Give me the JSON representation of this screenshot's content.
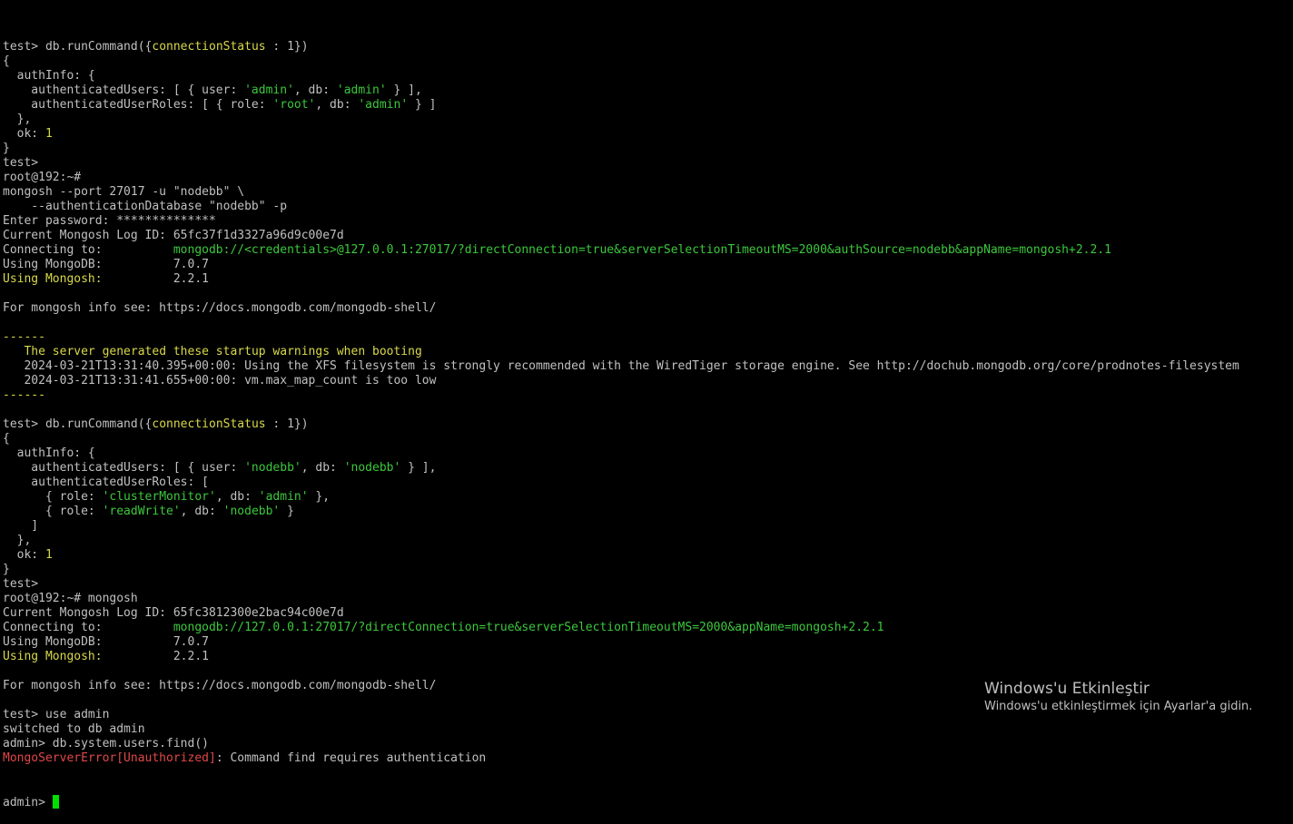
{
  "terminal": {
    "lines": [
      [
        {
          "t": "test> db.runCommand({",
          "c": "k"
        },
        {
          "t": "connectionStatus",
          "c": "y"
        },
        {
          "t": " : 1})",
          "c": "k"
        }
      ],
      [
        {
          "t": "{",
          "c": "k"
        }
      ],
      [
        {
          "t": "  authInfo: {",
          "c": "k"
        }
      ],
      [
        {
          "t": "    authenticatedUsers: [ { user: ",
          "c": "k"
        },
        {
          "t": "'admin'",
          "c": "g"
        },
        {
          "t": ", db: ",
          "c": "k"
        },
        {
          "t": "'admin'",
          "c": "g"
        },
        {
          "t": " } ],",
          "c": "k"
        }
      ],
      [
        {
          "t": "    authenticatedUserRoles: [ { role: ",
          "c": "k"
        },
        {
          "t": "'root'",
          "c": "g"
        },
        {
          "t": ", db: ",
          "c": "k"
        },
        {
          "t": "'admin'",
          "c": "g"
        },
        {
          "t": " } ]",
          "c": "k"
        }
      ],
      [
        {
          "t": "  },",
          "c": "k"
        }
      ],
      [
        {
          "t": "  ok: ",
          "c": "k"
        },
        {
          "t": "1",
          "c": "y"
        }
      ],
      [
        {
          "t": "}",
          "c": "k"
        }
      ],
      [
        {
          "t": "test>",
          "c": "k"
        }
      ],
      [
        {
          "t": "root@192:~#",
          "c": "k"
        }
      ],
      [
        {
          "t": "mongosh --port 27017 -u \"nodebb\" \\",
          "c": "k"
        }
      ],
      [
        {
          "t": "    --authenticationDatabase \"nodebb\" -p",
          "c": "k"
        }
      ],
      [
        {
          "t": "Enter password: **************",
          "c": "k"
        }
      ],
      [
        {
          "t": "Current Mongosh Log ID: 65fc37f1d3327a96d9c00e7d",
          "c": "k"
        }
      ],
      [
        {
          "t": "Connecting to:          ",
          "c": "k"
        },
        {
          "t": "mongodb://<credentials>@127.0.0.1:27017/?directConnection=true&serverSelectionTimeoutMS=2000&authSource=nodebb&appName=mongosh+2.2.1",
          "c": "g"
        }
      ],
      [
        {
          "t": "Using MongoDB:          7.0.7",
          "c": "k"
        }
      ],
      [
        {
          "t": "Using Mongosh:",
          "c": "y"
        },
        {
          "t": "          2.2.1",
          "c": "k"
        }
      ],
      [
        {
          "t": "",
          "c": "k"
        }
      ],
      [
        {
          "t": "For mongosh info see: https://docs.mongodb.com/mongodb-shell/",
          "c": "k"
        }
      ],
      [
        {
          "t": "",
          "c": "k"
        }
      ],
      [
        {
          "t": "------",
          "c": "y"
        }
      ],
      [
        {
          "t": "   ",
          "c": "k"
        },
        {
          "t": "The server generated these startup warnings when booting",
          "c": "y"
        }
      ],
      [
        {
          "t": "   2024-03-21T13:31:40.395+00:00: Using the XFS filesystem is strongly recommended with the WiredTiger storage engine. See http://dochub.mongodb.org/core/prodnotes-filesystem",
          "c": "k"
        }
      ],
      [
        {
          "t": "   2024-03-21T13:31:41.655+00:00: vm.max_map_count is too low",
          "c": "k"
        }
      ],
      [
        {
          "t": "------",
          "c": "y"
        }
      ],
      [
        {
          "t": "",
          "c": "k"
        }
      ],
      [
        {
          "t": "test> db.runCommand({",
          "c": "k"
        },
        {
          "t": "connectionStatus",
          "c": "y"
        },
        {
          "t": " : 1})",
          "c": "k"
        }
      ],
      [
        {
          "t": "{",
          "c": "k"
        }
      ],
      [
        {
          "t": "  authInfo: {",
          "c": "k"
        }
      ],
      [
        {
          "t": "    authenticatedUsers: [ { user: ",
          "c": "k"
        },
        {
          "t": "'nodebb'",
          "c": "g"
        },
        {
          "t": ", db: ",
          "c": "k"
        },
        {
          "t": "'nodebb'",
          "c": "g"
        },
        {
          "t": " } ],",
          "c": "k"
        }
      ],
      [
        {
          "t": "    authenticatedUserRoles: [",
          "c": "k"
        }
      ],
      [
        {
          "t": "      { role: ",
          "c": "k"
        },
        {
          "t": "'clusterMonitor'",
          "c": "g"
        },
        {
          "t": ", db: ",
          "c": "k"
        },
        {
          "t": "'admin'",
          "c": "g"
        },
        {
          "t": " },",
          "c": "k"
        }
      ],
      [
        {
          "t": "      { role: ",
          "c": "k"
        },
        {
          "t": "'readWrite'",
          "c": "g"
        },
        {
          "t": ", db: ",
          "c": "k"
        },
        {
          "t": "'nodebb'",
          "c": "g"
        },
        {
          "t": " }",
          "c": "k"
        }
      ],
      [
        {
          "t": "    ]",
          "c": "k"
        }
      ],
      [
        {
          "t": "  },",
          "c": "k"
        }
      ],
      [
        {
          "t": "  ok: ",
          "c": "k"
        },
        {
          "t": "1",
          "c": "y"
        }
      ],
      [
        {
          "t": "}",
          "c": "k"
        }
      ],
      [
        {
          "t": "test>",
          "c": "k"
        }
      ],
      [
        {
          "t": "root@192:~# mongosh",
          "c": "k"
        }
      ],
      [
        {
          "t": "Current Mongosh Log ID: 65fc3812300e2bac94c00e7d",
          "c": "k"
        }
      ],
      [
        {
          "t": "Connecting to:          ",
          "c": "k"
        },
        {
          "t": "mongodb://127.0.0.1:27017/?directConnection=true&serverSelectionTimeoutMS=2000&appName=mongosh+2.2.1",
          "c": "g"
        }
      ],
      [
        {
          "t": "Using MongoDB:          7.0.7",
          "c": "k"
        }
      ],
      [
        {
          "t": "Using Mongosh:",
          "c": "y"
        },
        {
          "t": "          2.2.1",
          "c": "k"
        }
      ],
      [
        {
          "t": "",
          "c": "k"
        }
      ],
      [
        {
          "t": "For mongosh info see: https://docs.mongodb.com/mongodb-shell/",
          "c": "k"
        }
      ],
      [
        {
          "t": "",
          "c": "k"
        }
      ],
      [
        {
          "t": "test> use admin",
          "c": "k"
        }
      ],
      [
        {
          "t": "switched to db admin",
          "c": "k"
        }
      ],
      [
        {
          "t": "admin> db.system.users.find()",
          "c": "k"
        }
      ],
      [
        {
          "t": "MongoServerError[Unauthorized]",
          "c": "r"
        },
        {
          "t": ": Command find requires authentication",
          "c": "k"
        }
      ]
    ],
    "prompt": "admin> "
  },
  "watermark": {
    "title": "Windows'u Etkinleştir",
    "subtitle": "Windows'u etkinleştirmek için Ayarlar'a gidin."
  },
  "colors": {
    "background": "#000000",
    "text": "#c0c0c0",
    "green": "#3cc83c",
    "yellow": "#d8d84a",
    "red": "#e04848",
    "cursor": "#00e000"
  }
}
